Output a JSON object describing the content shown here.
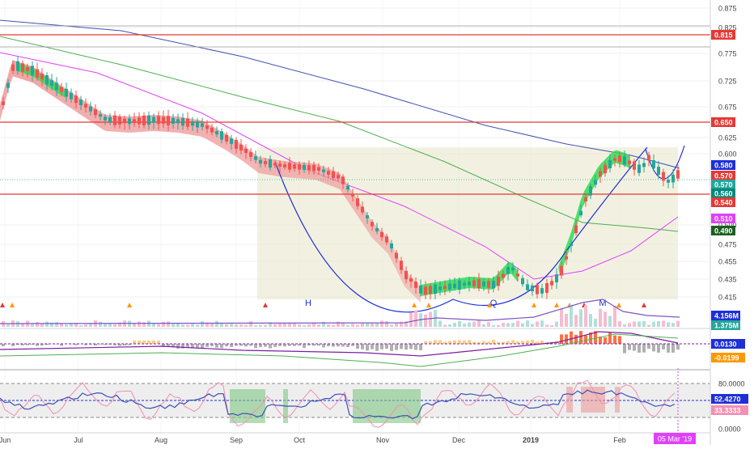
{
  "chart_data": {
    "type": "candlestick",
    "x_labels": [
      "Jun",
      "Jul",
      "Aug",
      "Sep",
      "Oct",
      "Nov",
      "Dec",
      "2019",
      "Feb"
    ],
    "price_axis": {
      "ticks": [
        "0.875",
        "0.825",
        "0.775",
        "0.725",
        "0.675",
        "0.625",
        "0.600",
        "0.500",
        "0.475",
        "0.455",
        "0.435",
        "0.415"
      ]
    },
    "horizontal_levels": [
      "0.815",
      "0.650",
      "0.540"
    ],
    "price_tags": [
      {
        "label": "0.815",
        "color": "#e53935"
      },
      {
        "label": "0.650",
        "color": "#e53935"
      },
      {
        "label": "0.580",
        "color": "#1e2fd8"
      },
      {
        "label": "0.570",
        "color": "#e53935"
      },
      {
        "label": "0.570",
        "color": "#26a69a"
      },
      {
        "label": "0.560",
        "color": "#00897b"
      },
      {
        "label": "0.540",
        "color": "#e53935"
      },
      {
        "label": "0.510",
        "color": "#e040fb"
      },
      {
        "label": "0.490",
        "color": "#1b5e20"
      }
    ],
    "pattern_letters": [
      "H",
      "Q",
      "M"
    ],
    "volume_tags": [
      {
        "label": "4.156M",
        "color": "#1e2fd8"
      },
      {
        "label": "1.375M",
        "color": "#26a69a"
      }
    ],
    "macd_tags": [
      {
        "label": "0.0130",
        "color": "#1e2fd8"
      },
      {
        "label": "-0.0199",
        "color": "#ff9800"
      }
    ],
    "rsi_axis": {
      "ticks": [
        "80.0000",
        "0.0000"
      ]
    },
    "rsi_tags": [
      {
        "label": "52.4270",
        "color": "#1e2fd8"
      },
      {
        "label": "33.3333",
        "color": "#f48fb1"
      }
    ],
    "cursor_date": "05 Mar '19",
    "colors": {
      "up": "#26a69a",
      "down": "#ef5350",
      "level": "#e53935",
      "ma_blue": "#3f51b5",
      "ma_green": "#4caf50",
      "ma_pink": "#e040fb",
      "cup": "#1e2fd8",
      "cloud": "#e8e6c8"
    }
  }
}
